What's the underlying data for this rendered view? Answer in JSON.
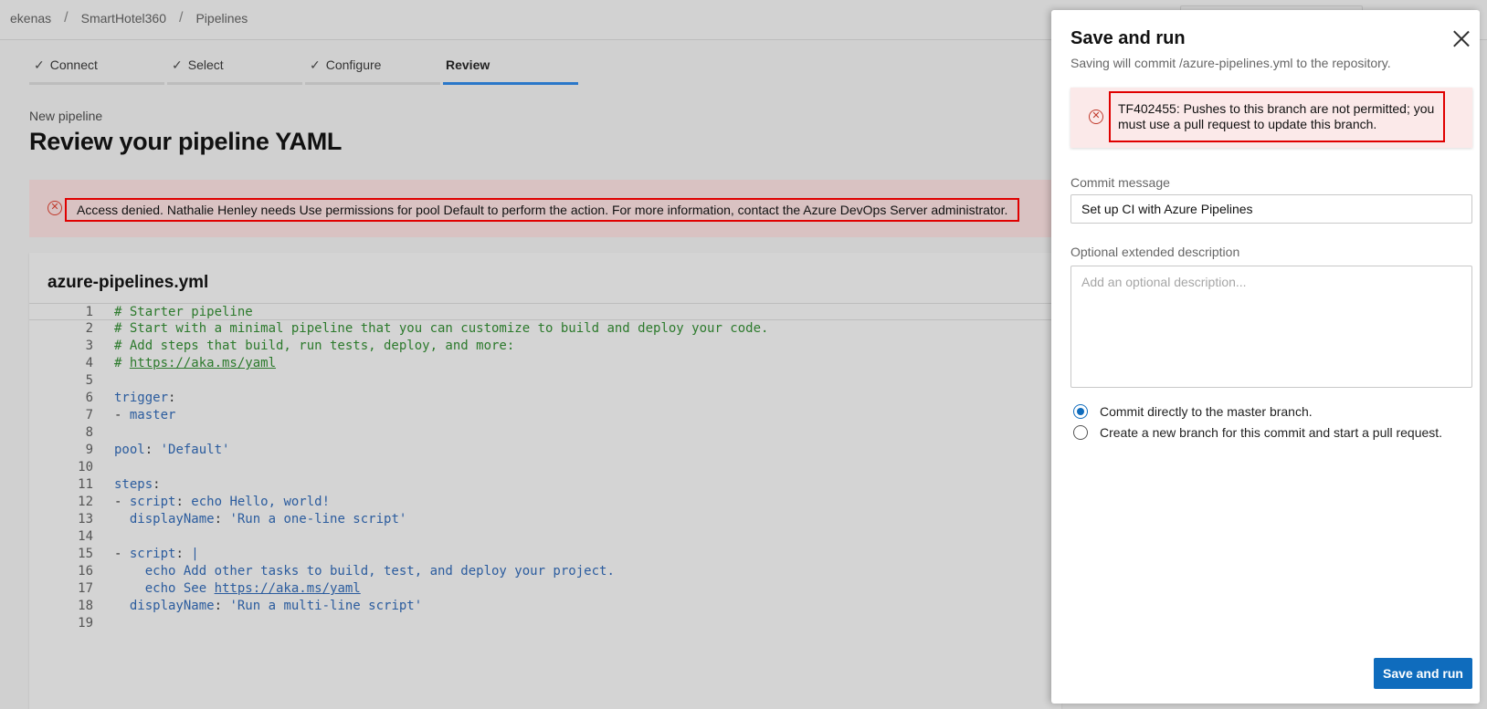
{
  "breadcrumb": {
    "org": "ekenas",
    "separator": "/",
    "project": "SmartHotel360",
    "section": "Pipelines"
  },
  "wizard": {
    "steps": [
      {
        "label": "Connect",
        "done": true
      },
      {
        "label": "Select",
        "done": true
      },
      {
        "label": "Configure",
        "done": true
      },
      {
        "label": "Review",
        "done": false,
        "active": true
      }
    ],
    "check_glyph": "✓"
  },
  "page": {
    "subtitle": "New pipeline",
    "title": "Review your pipeline YAML",
    "error": "Access denied. Nathalie Henley needs Use permissions for pool Default to perform the action. For more information, contact the Azure DevOps Server administrator."
  },
  "editor": {
    "file_name": "azure-pipelines.yml",
    "lines": [
      {
        "n": "1",
        "text": "# Starter pipeline"
      },
      {
        "n": "2",
        "text": "# Start with a minimal pipeline that you can customize to build and deploy your code."
      },
      {
        "n": "3",
        "text": "# Add steps that build, run tests, deploy, and more:"
      },
      {
        "n": "4",
        "text": "# https://aka.ms/yaml"
      },
      {
        "n": "5",
        "text": ""
      },
      {
        "n": "6",
        "text": "trigger:"
      },
      {
        "n": "7",
        "text": "- master"
      },
      {
        "n": "8",
        "text": ""
      },
      {
        "n": "9",
        "text": "pool: 'Default'"
      },
      {
        "n": "10",
        "text": ""
      },
      {
        "n": "11",
        "text": "steps:"
      },
      {
        "n": "12",
        "text": "- script: echo Hello, world!"
      },
      {
        "n": "13",
        "text": "  displayName: 'Run a one-line script'"
      },
      {
        "n": "14",
        "text": ""
      },
      {
        "n": "15",
        "text": "- script: |"
      },
      {
        "n": "16",
        "text": "    echo Add other tasks to build, test, and deploy your project."
      },
      {
        "n": "17",
        "text": "    echo See https://aka.ms/yaml"
      },
      {
        "n": "18",
        "text": "  displayName: 'Run a multi-line script'"
      },
      {
        "n": "19",
        "text": ""
      }
    ]
  },
  "panel": {
    "title": "Save and run",
    "subtitle": "Saving will commit /azure-pipelines.yml to the repository.",
    "error": "TF402455: Pushes to this branch are not permitted; you must use a pull request to update this branch.",
    "commit_label": "Commit message",
    "commit_value": "Set up CI with Azure Pipelines",
    "description_label": "Optional extended description",
    "description_placeholder": "Add an optional description...",
    "options": [
      {
        "label": "Commit directly to the master branch.",
        "checked": true
      },
      {
        "label": "Create a new branch for this commit and start a pull request.",
        "checked": false
      }
    ],
    "submit_label": "Save and run"
  },
  "colors": {
    "primary": "#0f6cbd",
    "error_outline": "#e00000",
    "error_icon": "#c0392b",
    "comment": "#2c7a2c",
    "yaml_token": "#2b5c9e",
    "wizard_active": "#2a77c9"
  },
  "icons": {
    "error": "error-circle-icon",
    "close": "close-icon",
    "check": "check-icon"
  }
}
